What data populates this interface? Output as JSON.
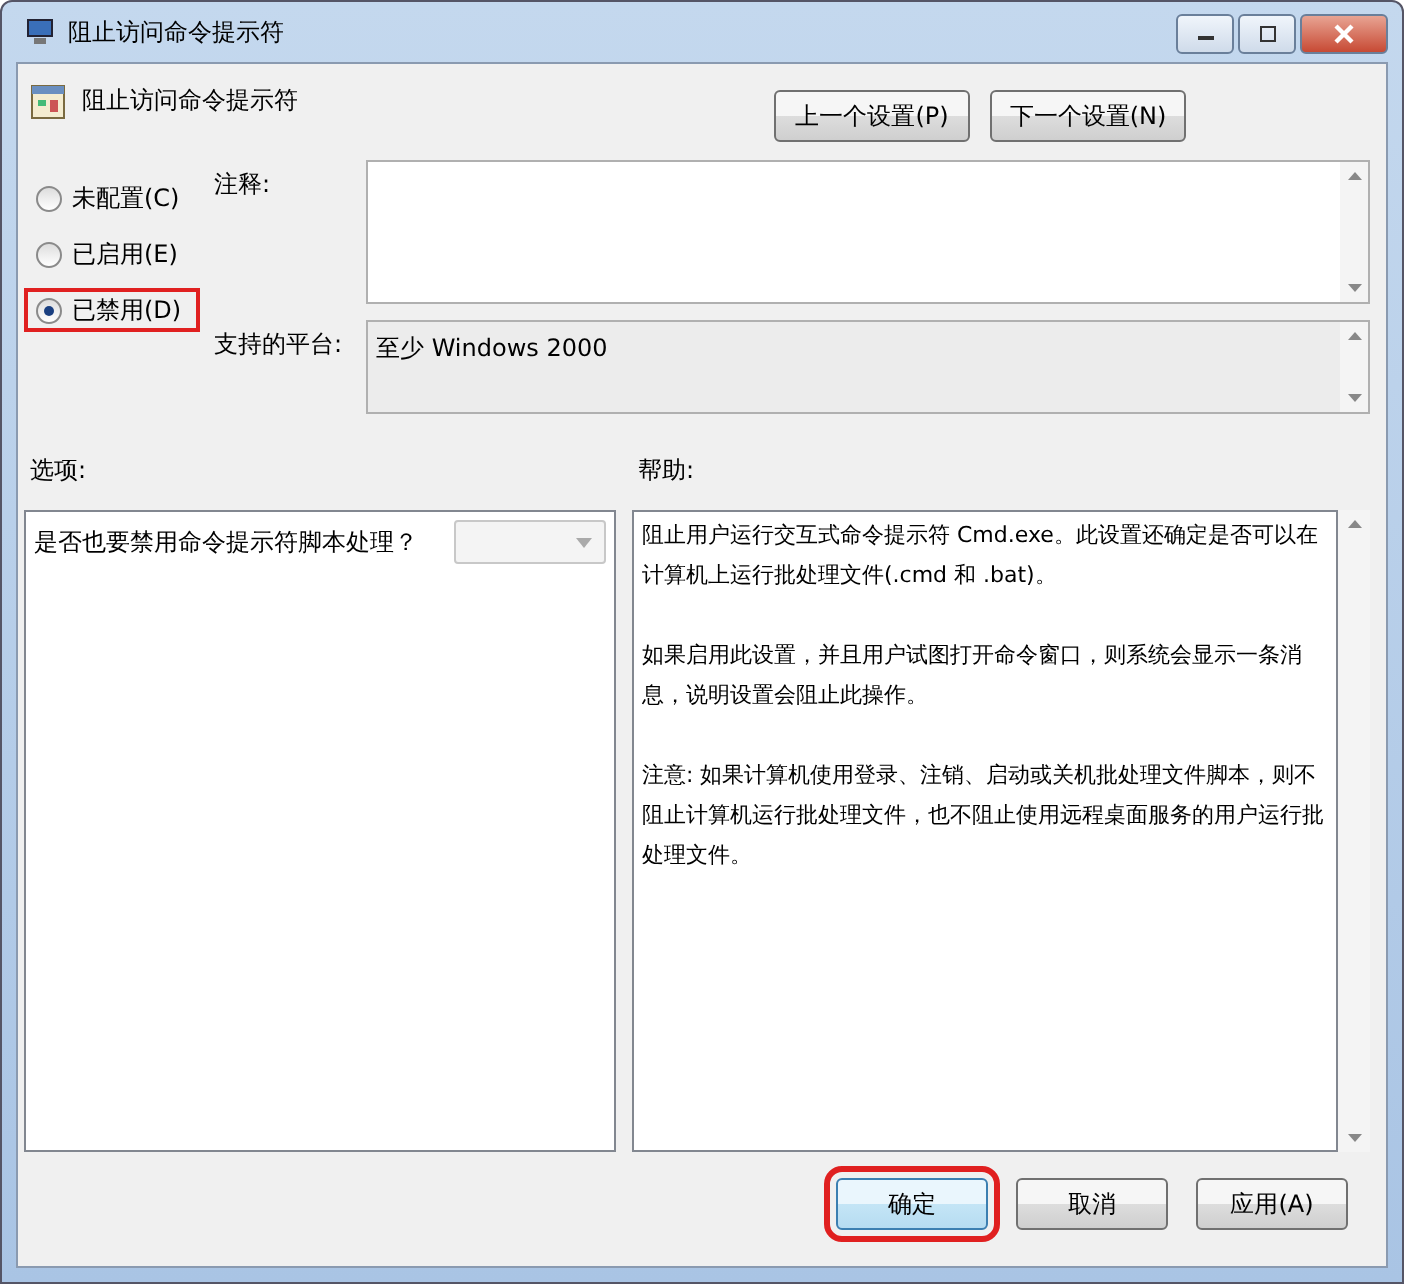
{
  "window": {
    "title": "阻止访问命令提示符"
  },
  "policy": {
    "name": "阻止访问命令提示符"
  },
  "nav_buttons": [
    "上一个设置(P)",
    "下一个设置(N)"
  ],
  "states": [
    {
      "label": "未配置(C)",
      "selected": false,
      "highlighted": false
    },
    {
      "label": "已启用(E)",
      "selected": false,
      "highlighted": false
    },
    {
      "label": "已禁用(D)",
      "selected": true,
      "highlighted": true
    }
  ],
  "comment": {
    "label": "注释:"
  },
  "platform": {
    "label": "支持的平台:",
    "value": "至少 Windows 2000"
  },
  "options": {
    "label": "选项:",
    "question": "是否也要禁用命令提示符脚本处理？",
    "dropdown_disabled": true
  },
  "help": {
    "label": "帮助:",
    "paragraphs": [
      "阻止用户运行交互式命令提示符 Cmd.exe。此设置还确定是否可以在计算机上运行批处理文件(.cmd 和 .bat)。",
      "如果启用此设置，并且用户试图打开命令窗口，则系统会显示一条消息，说明设置会阻止此操作。",
      "注意: 如果计算机使用登录、注销、启动或关机批处理文件脚本，则不阻止计算机运行批处理文件，也不阻止使用远程桌面服务的用户运行批处理文件。"
    ]
  },
  "buttons": [
    {
      "label": "确定",
      "default": true,
      "highlighted": true
    },
    {
      "label": "取消",
      "default": false,
      "highlighted": false
    },
    {
      "label": "应用(A)",
      "default": false,
      "highlighted": false
    }
  ]
}
